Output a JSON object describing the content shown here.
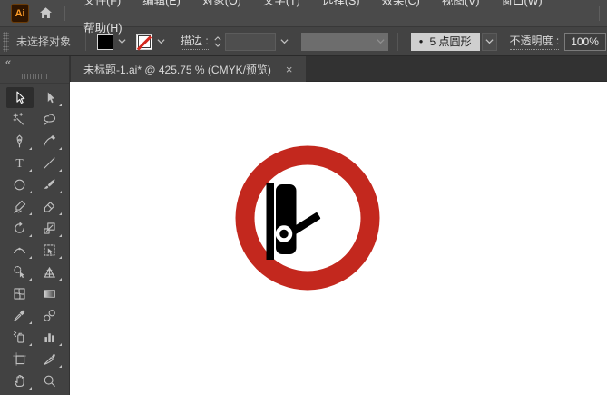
{
  "menubar": {
    "logo_text": "Ai",
    "menus": [
      {
        "name": "file",
        "label": "文件(F)"
      },
      {
        "name": "edit",
        "label": "编辑(E)"
      },
      {
        "name": "object",
        "label": "对象(O)"
      },
      {
        "name": "type",
        "label": "文字(T)"
      },
      {
        "name": "select",
        "label": "选择(S)"
      },
      {
        "name": "effect",
        "label": "效果(C)"
      },
      {
        "name": "view",
        "label": "视图(V)"
      },
      {
        "name": "window",
        "label": "窗口(W)"
      },
      {
        "name": "help",
        "label": "帮助(H)"
      }
    ]
  },
  "controlbar": {
    "status": "未选择对象",
    "stroke_label": "描边 :",
    "brush_bullet": "●",
    "brush_name": "5 点圆形",
    "opacity_label": "不透明度 :",
    "opacity_value": "100%"
  },
  "tabbar": {
    "title": "未标题-1.ai* @ 425.75 % (CMYK/预览)",
    "close_glyph": "×"
  },
  "toolbar": {
    "collapse_glyph": "«",
    "tools": [
      {
        "name": "selection-tool",
        "selected": true,
        "flyout": false
      },
      {
        "name": "direct-selection-tool",
        "selected": false,
        "flyout": true
      },
      {
        "name": "magic-wand-tool",
        "selected": false,
        "flyout": false
      },
      {
        "name": "lasso-tool",
        "selected": false,
        "flyout": false
      },
      {
        "name": "pen-tool",
        "selected": false,
        "flyout": true
      },
      {
        "name": "curvature-tool",
        "selected": false,
        "flyout": true
      },
      {
        "name": "type-tool",
        "selected": false,
        "flyout": true
      },
      {
        "name": "line-segment-tool",
        "selected": false,
        "flyout": true
      },
      {
        "name": "ellipse-tool",
        "selected": false,
        "flyout": true
      },
      {
        "name": "paintbrush-tool",
        "selected": false,
        "flyout": true
      },
      {
        "name": "shaper-tool",
        "selected": false,
        "flyout": true
      },
      {
        "name": "eraser-tool",
        "selected": false,
        "flyout": true
      },
      {
        "name": "rotate-tool",
        "selected": false,
        "flyout": true
      },
      {
        "name": "scale-tool",
        "selected": false,
        "flyout": true
      },
      {
        "name": "width-tool",
        "selected": false,
        "flyout": true
      },
      {
        "name": "free-transform-tool",
        "selected": false,
        "flyout": true
      },
      {
        "name": "shape-builder-tool",
        "selected": false,
        "flyout": true
      },
      {
        "name": "perspective-grid-tool",
        "selected": false,
        "flyout": true
      },
      {
        "name": "mesh-tool",
        "selected": false,
        "flyout": false
      },
      {
        "name": "gradient-tool",
        "selected": false,
        "flyout": false
      },
      {
        "name": "eyedropper-tool",
        "selected": false,
        "flyout": true
      },
      {
        "name": "blend-tool",
        "selected": false,
        "flyout": false
      },
      {
        "name": "symbol-sprayer-tool",
        "selected": false,
        "flyout": true
      },
      {
        "name": "column-graph-tool",
        "selected": false,
        "flyout": true
      },
      {
        "name": "artboard-tool",
        "selected": false,
        "flyout": false
      },
      {
        "name": "slice-tool",
        "selected": false,
        "flyout": true
      },
      {
        "name": "hand-tool",
        "selected": false,
        "flyout": true
      },
      {
        "name": "zoom-tool",
        "selected": false,
        "flyout": false
      }
    ]
  },
  "canvas": {
    "sign": {
      "ring_color": "#c3281e",
      "inner_color": "#ffffff",
      "icon_color": "#000000"
    }
  }
}
